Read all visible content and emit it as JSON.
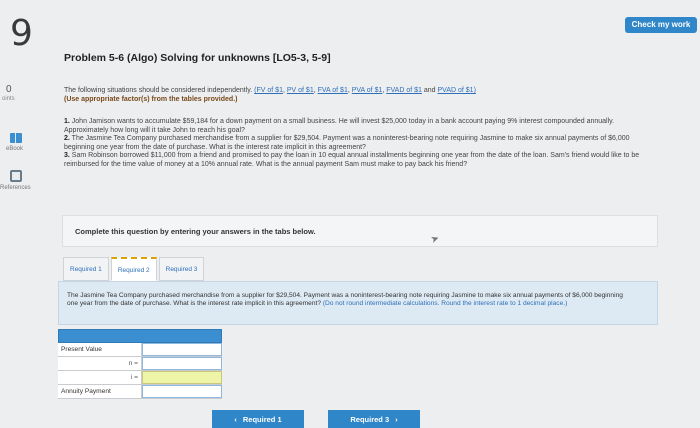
{
  "question_number": "9",
  "check_button": "Check my work",
  "left_rail": {
    "points_value": "0",
    "points_label": "oints",
    "ebook_label": "eBook",
    "references_label": "References"
  },
  "problem_title": "Problem 5-6 (Algo) Solving for unknowns [LO5-3, 5-9]",
  "intro": {
    "text": "The following situations should be considered independently. ",
    "links": [
      "(FV of $1",
      "PV of $1",
      "FVA of $1",
      "PVA of $1",
      "FVAD of $1",
      "PVAD of $1)"
    ],
    "and": "and",
    "instruction": "(Use appropriate factor(s) from the tables provided.)"
  },
  "situations": [
    {
      "num": "1.",
      "text": " John Jamison wants to accumulate $59,184 for a down payment on a small business. He will invest $25,000 today in a bank account paying 9% interest compounded annually. Approximately how long will it take John to reach his goal?"
    },
    {
      "num": "2.",
      "text": " The Jasmine Tea Company purchased merchandise from a supplier for $29,504. Payment was a noninterest-bearing note requiring Jasmine to make six annual payments of $6,000 beginning one year from the date of purchase. What is the interest rate implicit in this agreement?"
    },
    {
      "num": "3.",
      "text": " Sam Robinson borrowed $11,000 from a friend and promised to pay the loan in 10 equal annual installments beginning one year from the date of the loan. Sam's friend would like to be reimbursed for the time value of money at a 10% annual rate. What is the annual payment Sam must make to pay back his friend?"
    }
  ],
  "complete_text": "Complete this question by entering your answers in the tabs below.",
  "tabs": [
    "Required 1",
    "Required 2",
    "Required 3"
  ],
  "active_tab": "Required 2",
  "panel": {
    "text": "The Jasmine Tea Company purchased merchandise from a supplier for $29,504. Payment was a noninterest-bearing note requiring Jasmine to make six annual payments of $6,000 beginning one year from the date of purchase. What is the interest rate implicit in this agreement? ",
    "hint": "(Do not round intermediate calculations. Round the interest rate to 1 decimal place.)"
  },
  "calc": {
    "rows": [
      {
        "label": "Present Value",
        "sub": ""
      },
      {
        "label": "",
        "sub": "n ="
      },
      {
        "label": "",
        "sub": "i ="
      },
      {
        "label": "Annuity Payment",
        "sub": ""
      }
    ]
  },
  "nav": {
    "prev_label": "Required 1",
    "next_label": "Required 3"
  }
}
